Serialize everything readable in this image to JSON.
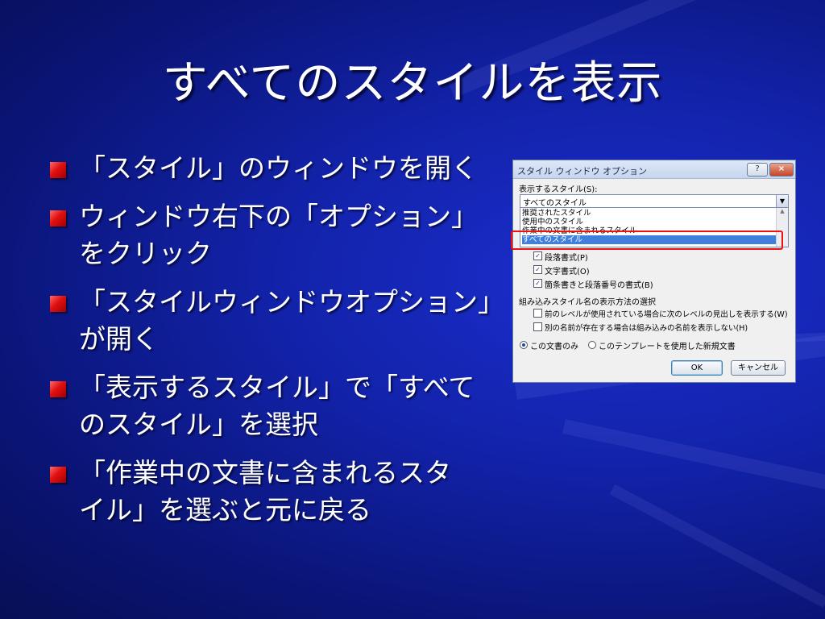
{
  "slide": {
    "title": "すべてのスタイルを表示",
    "bullets": [
      {
        "lines": [
          "「スタイル」のウィンドウを開く"
        ]
      },
      {
        "lines": [
          "ウィンドウ右下の「オプション」",
          "をクリック"
        ]
      },
      {
        "lines": [
          "「スタイルウィンドウオプション」",
          "が開く"
        ]
      },
      {
        "lines": [
          "「表示するスタイル」で「すべて",
          "のスタイル」を選択"
        ]
      },
      {
        "lines": [
          "「作業中の文書に含まれるスタ",
          "イル」を選ぶと元に戻る"
        ]
      }
    ]
  },
  "dialog": {
    "title": "スタイル ウィンドウ オプション",
    "help_label": "?",
    "close_label": "×",
    "show_styles_label": "表示するスタイル(S):",
    "combo_value": "すべてのスタイル",
    "combo_arrow": "▼",
    "dropdown_items": [
      "推奨されたスタイル",
      "使用中のスタイル",
      "作業中の文書に含まれるスタイル",
      "すべてのスタイル"
    ],
    "scroll_up": "▲",
    "checks": [
      {
        "label": "段落書式(P)",
        "checked": true
      },
      {
        "label": "文字書式(O)",
        "checked": true
      },
      {
        "label": "箇条書きと段落番号の書式(B)",
        "checked": true
      }
    ],
    "builtin_label": "組み込みスタイル名の表示方法の選択",
    "builtin_checks": [
      {
        "label": "前のレベルが使用されている場合に次のレベルの見出しを表示する(W)",
        "checked": false
      },
      {
        "label": "別の名前が存在する場合は組み込みの名前を表示しない(H)",
        "checked": false
      }
    ],
    "radio_this_doc": "この文書のみ",
    "radio_template": "このテンプレートを使用した新規文書",
    "ok_label": "OK",
    "cancel_label": "キャンセル",
    "checkmark": "✓"
  },
  "colors": {
    "background": "#1222a8",
    "bullet_marker": "#e01010",
    "highlight": "#f01010",
    "selection": "#3f80de"
  }
}
